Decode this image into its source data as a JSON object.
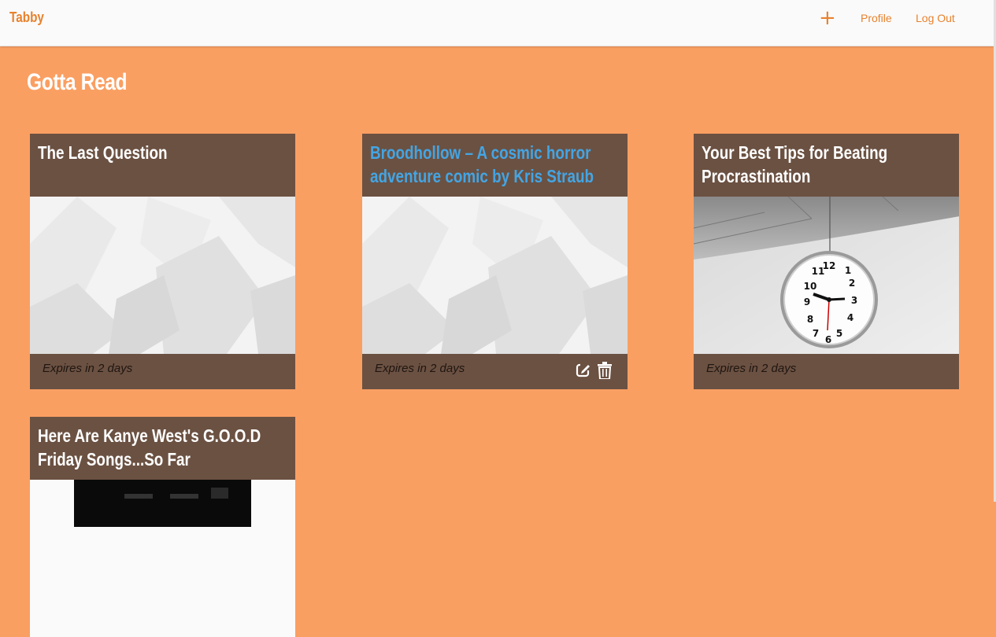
{
  "nav": {
    "brand": "Tabby",
    "add_label": "+",
    "profile_label": "Profile",
    "logout_label": "Log Out"
  },
  "page": {
    "title": "Gotta Read"
  },
  "cards": [
    {
      "title": "The Last Question",
      "expires": "Expires in 2 days",
      "image": "placeholder-pattern"
    },
    {
      "title": "Broodhollow – A cosmic horror adventure comic by Kris Straub",
      "expires": "Expires in 2 days",
      "image": "placeholder-pattern",
      "actions": [
        "edit-icon",
        "trash-icon"
      ]
    },
    {
      "title": "Your Best Tips for Beating Procrastination",
      "expires": "Expires in 2 days",
      "image": "wall-clock"
    },
    {
      "title": "Here Are Kanye West's G.O.O.D Friday Songs...So Far",
      "image": "album-cover"
    }
  ],
  "colors": {
    "background": "#fa9f62",
    "card": "#6b5142",
    "accent": "#e8822e",
    "hover_link": "#43a5e4"
  }
}
